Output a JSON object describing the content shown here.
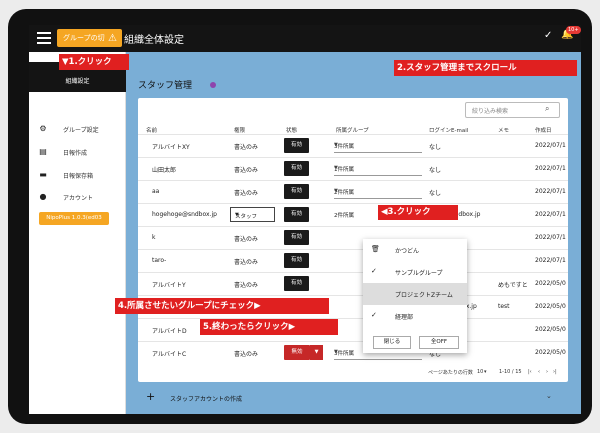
{
  "topbar": {
    "group_button": "グループの切",
    "group_warn": "⚠",
    "title": "組織全体設定",
    "check_icon": "✓",
    "bell_icon": "🔔",
    "badge": "10+"
  },
  "annotations": {
    "a1": "▼1.クリック",
    "a2": "2.スタッフ管理までスクロール",
    "a3": "◀3.クリック",
    "a4": "4.所属させたいグループにチェック▶",
    "a5": "5.終わったらクリック▶"
  },
  "sidebar": {
    "header": "組織設定",
    "items": [
      {
        "icon": "gear-icon",
        "glyph": "⚙",
        "label": "グループ設定"
      },
      {
        "icon": "document-add-icon",
        "glyph": "▤",
        "label": "日報作成"
      },
      {
        "icon": "folder-icon",
        "glyph": "▬",
        "label": "日報保存箱"
      },
      {
        "icon": "account-icon",
        "glyph": "●",
        "label": "アカウント"
      }
    ],
    "version": "NipoPlus 1.0.3(ed03"
  },
  "main": {
    "title": "スタッフ管理",
    "search_placeholder": "絞り込み検索",
    "columns": {
      "name": "名前",
      "role": "権限",
      "status": "状態",
      "group": "所属グループ",
      "email": "ログインE-mail",
      "memo": "メモ",
      "created": "作成日"
    },
    "rows": [
      {
        "name": "アルバイトXY",
        "role": "書込のみ",
        "status": "有効",
        "group": "3件所属",
        "email": "なし",
        "memo": "",
        "created": "2022/07/1"
      },
      {
        "name": "山田太郎",
        "role": "書込のみ",
        "status": "有効",
        "group": "1件所属",
        "email": "なし",
        "memo": "",
        "created": "2022/07/1"
      },
      {
        "name": "aa",
        "role": "書込のみ",
        "status": "有効",
        "group": "2件所属",
        "email": "なし",
        "memo": "",
        "created": "2022/07/1"
      },
      {
        "name": "hogehoge@sndbox.jp",
        "role": "スタッフ",
        "status": "有効",
        "group": "2件所属",
        "email": "ge@sndbox.jp",
        "memo": "",
        "created": "2022/07/1"
      },
      {
        "name": "k",
        "role": "書込のみ",
        "status": "有効",
        "group": "",
        "email": "",
        "memo": "",
        "created": "2022/07/1"
      },
      {
        "name": "taro-",
        "role": "書込のみ",
        "status": "有効",
        "group": "",
        "email": "",
        "memo": "",
        "created": "2022/07/1"
      },
      {
        "name": "アルバイトY",
        "role": "書込のみ",
        "status": "有効",
        "group": "",
        "email": "",
        "memo": "めもですと",
        "created": "2022/05/0"
      },
      {
        "name": "",
        "role": "",
        "status": "",
        "group": "",
        "email": "p@sndbox.jp",
        "memo": "test",
        "created": "2022/05/0"
      },
      {
        "name": "アルバイトD",
        "role": "",
        "status": "",
        "group": "",
        "email": "",
        "memo": "",
        "created": "2022/05/0"
      },
      {
        "name": "アルバイトC",
        "role": "書込のみ",
        "status": "無効",
        "group": "3件所属",
        "email": "なし",
        "memo": "",
        "created": "2022/05/0"
      }
    ],
    "dropdown": {
      "items": [
        {
          "mark": "🗑",
          "label": "かつどん"
        },
        {
          "mark": "✓",
          "label": "サンプルグループ"
        },
        {
          "mark": "",
          "label": "プロジェクトZチーム"
        },
        {
          "mark": "✓",
          "label": "経理部"
        }
      ],
      "close": "閉じる",
      "all_off": "全OFF"
    },
    "pager": {
      "rows_label": "ページあたりの行数",
      "rows_value": "10",
      "range": "1-10 / 15",
      "first": "|‹",
      "prev": "‹",
      "next": "›",
      "last": "›|"
    },
    "footer": {
      "plus": "+",
      "label": "スタッフアカウントの作成",
      "chev": "⌄"
    }
  }
}
